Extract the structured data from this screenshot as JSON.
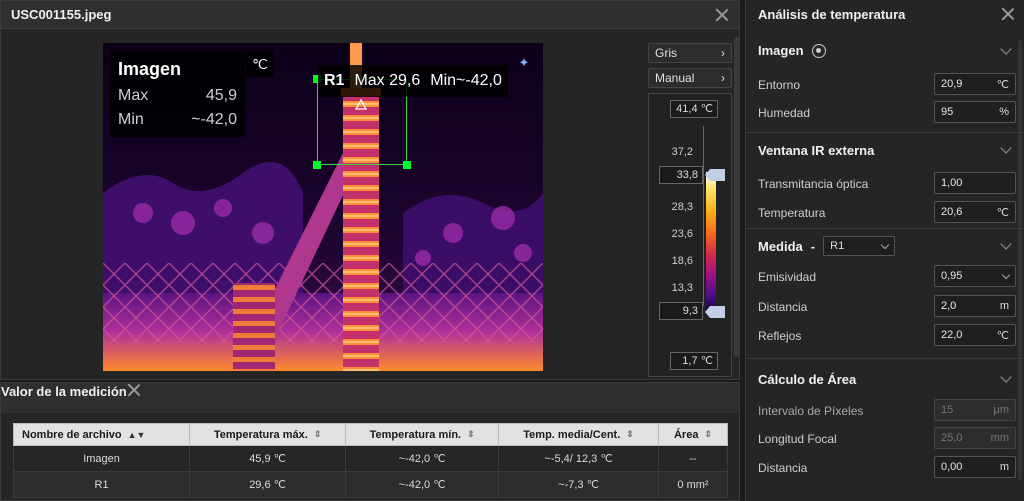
{
  "image_window": {
    "title": "USC001155.jpeg",
    "overlay": {
      "title": "Imagen",
      "unit": "℃",
      "max_label": "Max",
      "max_value": "45,9",
      "min_label": "Min",
      "min_value": "~-42,0"
    },
    "roi": {
      "name": "R1",
      "max_text": "Max 29,6",
      "min_text": "Min~-42,0"
    },
    "palette_button": "Gris",
    "mode_button": "Manual",
    "scale": {
      "top_value": "41,4 ℃",
      "bottom_value": "1,7 ℃",
      "upper_thumb_value": "33,8",
      "lower_thumb_value": "9,3",
      "ticks": [
        "37,2",
        "28,3",
        "23,6",
        "18,6",
        "13,3"
      ]
    }
  },
  "measurement_window": {
    "title": "Valor de la medición",
    "columns": [
      "Nombre de archivo",
      "Temperatura máx.",
      "Temperatura mín.",
      "Temp. media/Cent.",
      "Área"
    ],
    "rows": [
      [
        "Imagen",
        "45,9 ℃",
        "~-42,0 ℃",
        "~-5,4/ 12,3 ℃",
        "--"
      ],
      [
        "R1",
        "29,6 ℃",
        "~-42,0 ℃",
        "~-7,3 ℃",
        "0 mm²"
      ]
    ]
  },
  "right_panel": {
    "title": "Análisis de temperatura",
    "imagen": {
      "title": "Imagen",
      "entorno_label": "Entorno",
      "entorno_value": "20,9",
      "entorno_unit": "℃",
      "humedad_label": "Humedad",
      "humedad_value": "95",
      "humedad_unit": "%"
    },
    "ventana": {
      "title": "Ventana IR externa",
      "trans_label": "Transmitancia óptica",
      "trans_value": "1,00",
      "temp_label": "Temperatura",
      "temp_value": "20,6",
      "temp_unit": "℃"
    },
    "medida": {
      "title": "Medida",
      "separator": "-",
      "select_value": "R1",
      "emis_label": "Emisividad",
      "emis_value": "0,95",
      "dist_label": "Distancia",
      "dist_value": "2,0",
      "dist_unit": "m",
      "refl_label": "Reflejos",
      "refl_value": "22,0",
      "refl_unit": "℃"
    },
    "area": {
      "title": "Cálculo de Área",
      "pix_label": "Intervalo de Píxeles",
      "pix_value": "15",
      "pix_unit": "μm",
      "focal_label": "Longitud Focal",
      "focal_value": "25,0",
      "focal_unit": "mm",
      "dist_label": "Distancia",
      "dist_value": "0,00",
      "dist_unit": "m"
    }
  }
}
